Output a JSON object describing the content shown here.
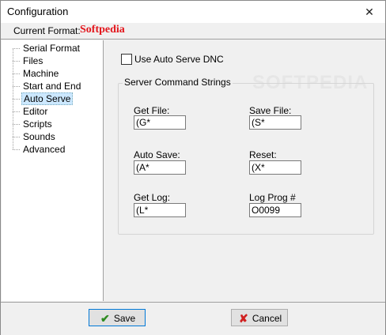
{
  "window": {
    "title": "Configuration",
    "close_glyph": "✕"
  },
  "format": {
    "label": "Current Format:",
    "value": "Softpedia",
    "value_color": "#e3161c"
  },
  "tree": {
    "items": [
      {
        "label": "Serial Format"
      },
      {
        "label": "Files"
      },
      {
        "label": "Machine"
      },
      {
        "label": "Start and End"
      },
      {
        "label": "Auto Serve",
        "selected": true
      },
      {
        "label": "Editor"
      },
      {
        "label": "Scripts"
      },
      {
        "label": "Sounds"
      },
      {
        "label": "Advanced"
      }
    ]
  },
  "auto_serve": {
    "use_dnc_label": "Use Auto Serve DNC",
    "use_dnc_checked": false,
    "group_title": "Server Command Strings",
    "get_file_label": "Get File:",
    "get_file_value": "(G*",
    "save_file_label": "Save File:",
    "save_file_value": "(S*",
    "auto_save_label": "Auto Save:",
    "auto_save_value": "(A*",
    "reset_label": "Reset:",
    "reset_value": "(X*",
    "get_log_label": "Get Log:",
    "get_log_value": "(L*",
    "log_prog_label": "Log Prog #",
    "log_prog_value": "O0099"
  },
  "watermark": "SOFTPEDIA",
  "footer": {
    "save_label": "Save",
    "cancel_label": "Cancel",
    "save_icon": "check-icon",
    "cancel_icon": "x-icon"
  }
}
